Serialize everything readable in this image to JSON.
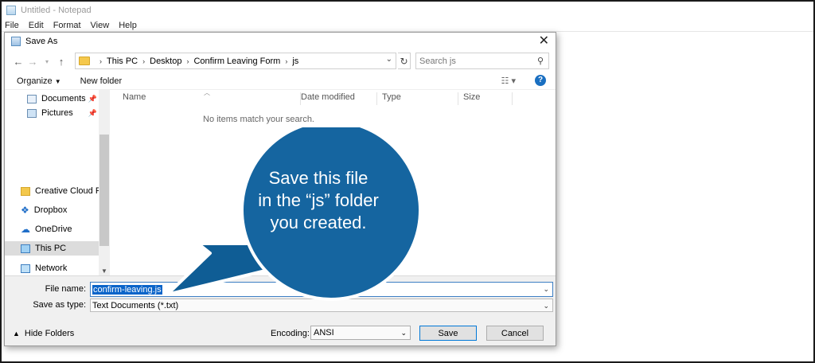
{
  "notepad": {
    "title": "Untitled - Notepad",
    "menu": [
      "File",
      "Edit",
      "Format",
      "View",
      "Help"
    ]
  },
  "dialog": {
    "title": "Save As",
    "breadcrumb": [
      "This PC",
      "Desktop",
      "Confirm Leaving Form",
      "js"
    ],
    "search_placeholder": "Search js",
    "toolbar": {
      "organize": "Organize",
      "new_folder": "New folder"
    },
    "nav_items": [
      {
        "label": "Documents",
        "icon": "documents-icon",
        "pinned": true
      },
      {
        "label": "Pictures",
        "icon": "pictures-icon",
        "pinned": true
      },
      {
        "label": "Creative Cloud Fil",
        "icon": "creative-cloud-icon",
        "pinned": false
      },
      {
        "label": "Dropbox",
        "icon": "dropbox-icon",
        "pinned": false
      },
      {
        "label": "OneDrive",
        "icon": "onedrive-icon",
        "pinned": false
      },
      {
        "label": "This PC",
        "icon": "computer-icon",
        "pinned": false,
        "selected": true
      },
      {
        "label": "Network",
        "icon": "network-icon",
        "pinned": false
      }
    ],
    "columns": [
      "Name",
      "Date modified",
      "Type",
      "Size"
    ],
    "empty_message": "No items match your search.",
    "file_name_label": "File name:",
    "file_name_value": "confirm-leaving.js",
    "save_type_label": "Save as type:",
    "save_type_value": "Text Documents (*.txt)",
    "hide_folders": "Hide Folders",
    "encoding_label": "Encoding:",
    "encoding_value": "ANSI",
    "save_button": "Save",
    "cancel_button": "Cancel"
  },
  "callout": {
    "line1": "Save this file",
    "line2": "in the “js” folder",
    "line3": "you created.",
    "color": "#1565a0"
  }
}
